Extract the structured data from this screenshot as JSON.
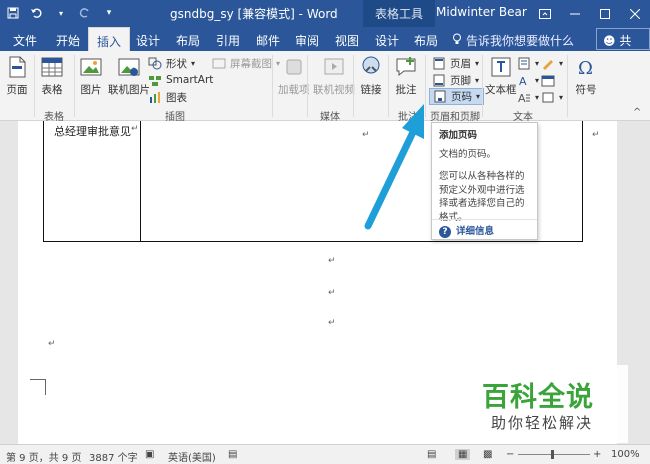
{
  "titlebar": {
    "title": "gsndbg_sy [兼容模式] - Word",
    "context_tab": "表格工具",
    "user": "Midwinter Bear"
  },
  "tabs": {
    "items": [
      "文件",
      "开始",
      "插入",
      "设计",
      "布局",
      "引用",
      "邮件",
      "审阅",
      "视图",
      "设计",
      "布局"
    ],
    "active": "插入",
    "tell_me": "告诉我你想要做什么",
    "share": "共享"
  },
  "ribbon": {
    "pages": "页面",
    "table": "表格",
    "picture": "图片",
    "online_picture": "联机图片",
    "shapes": "形状",
    "smartart": "SmartArt",
    "chart": "图表",
    "screenshot": "屏幕截图",
    "addins": "加载项",
    "online_video": "联机视频",
    "link": "链接",
    "comment": "批注",
    "header": "页眉",
    "footer": "页脚",
    "page_number": "页码",
    "textbox": "文本框",
    "symbol": "符号",
    "groups": {
      "tables": "表格",
      "illustrations": "插图",
      "media": "媒体",
      "comments": "批注",
      "header_footer": "页眉和页脚",
      "text": "文本"
    }
  },
  "document": {
    "cell_text": "总经理审批意见",
    "para_mark": "↵"
  },
  "tooltip": {
    "title": "添加页码",
    "line1": "文档的页码。",
    "line2": "您可以从各种各样的预定义外观中进行选择或者选择您自己的格式。",
    "more": "详细信息"
  },
  "status": {
    "page": "第 9 页，共 9 页",
    "words": "3887 个字",
    "lang": "英语(美国)",
    "zoom": "100%"
  },
  "watermark": {
    "title": "百科全说",
    "subtitle": "助你轻松解决"
  },
  "colors": {
    "brand": "#2b579a",
    "arrow": "#1f9fd9",
    "watermark": "#3aa33a"
  }
}
